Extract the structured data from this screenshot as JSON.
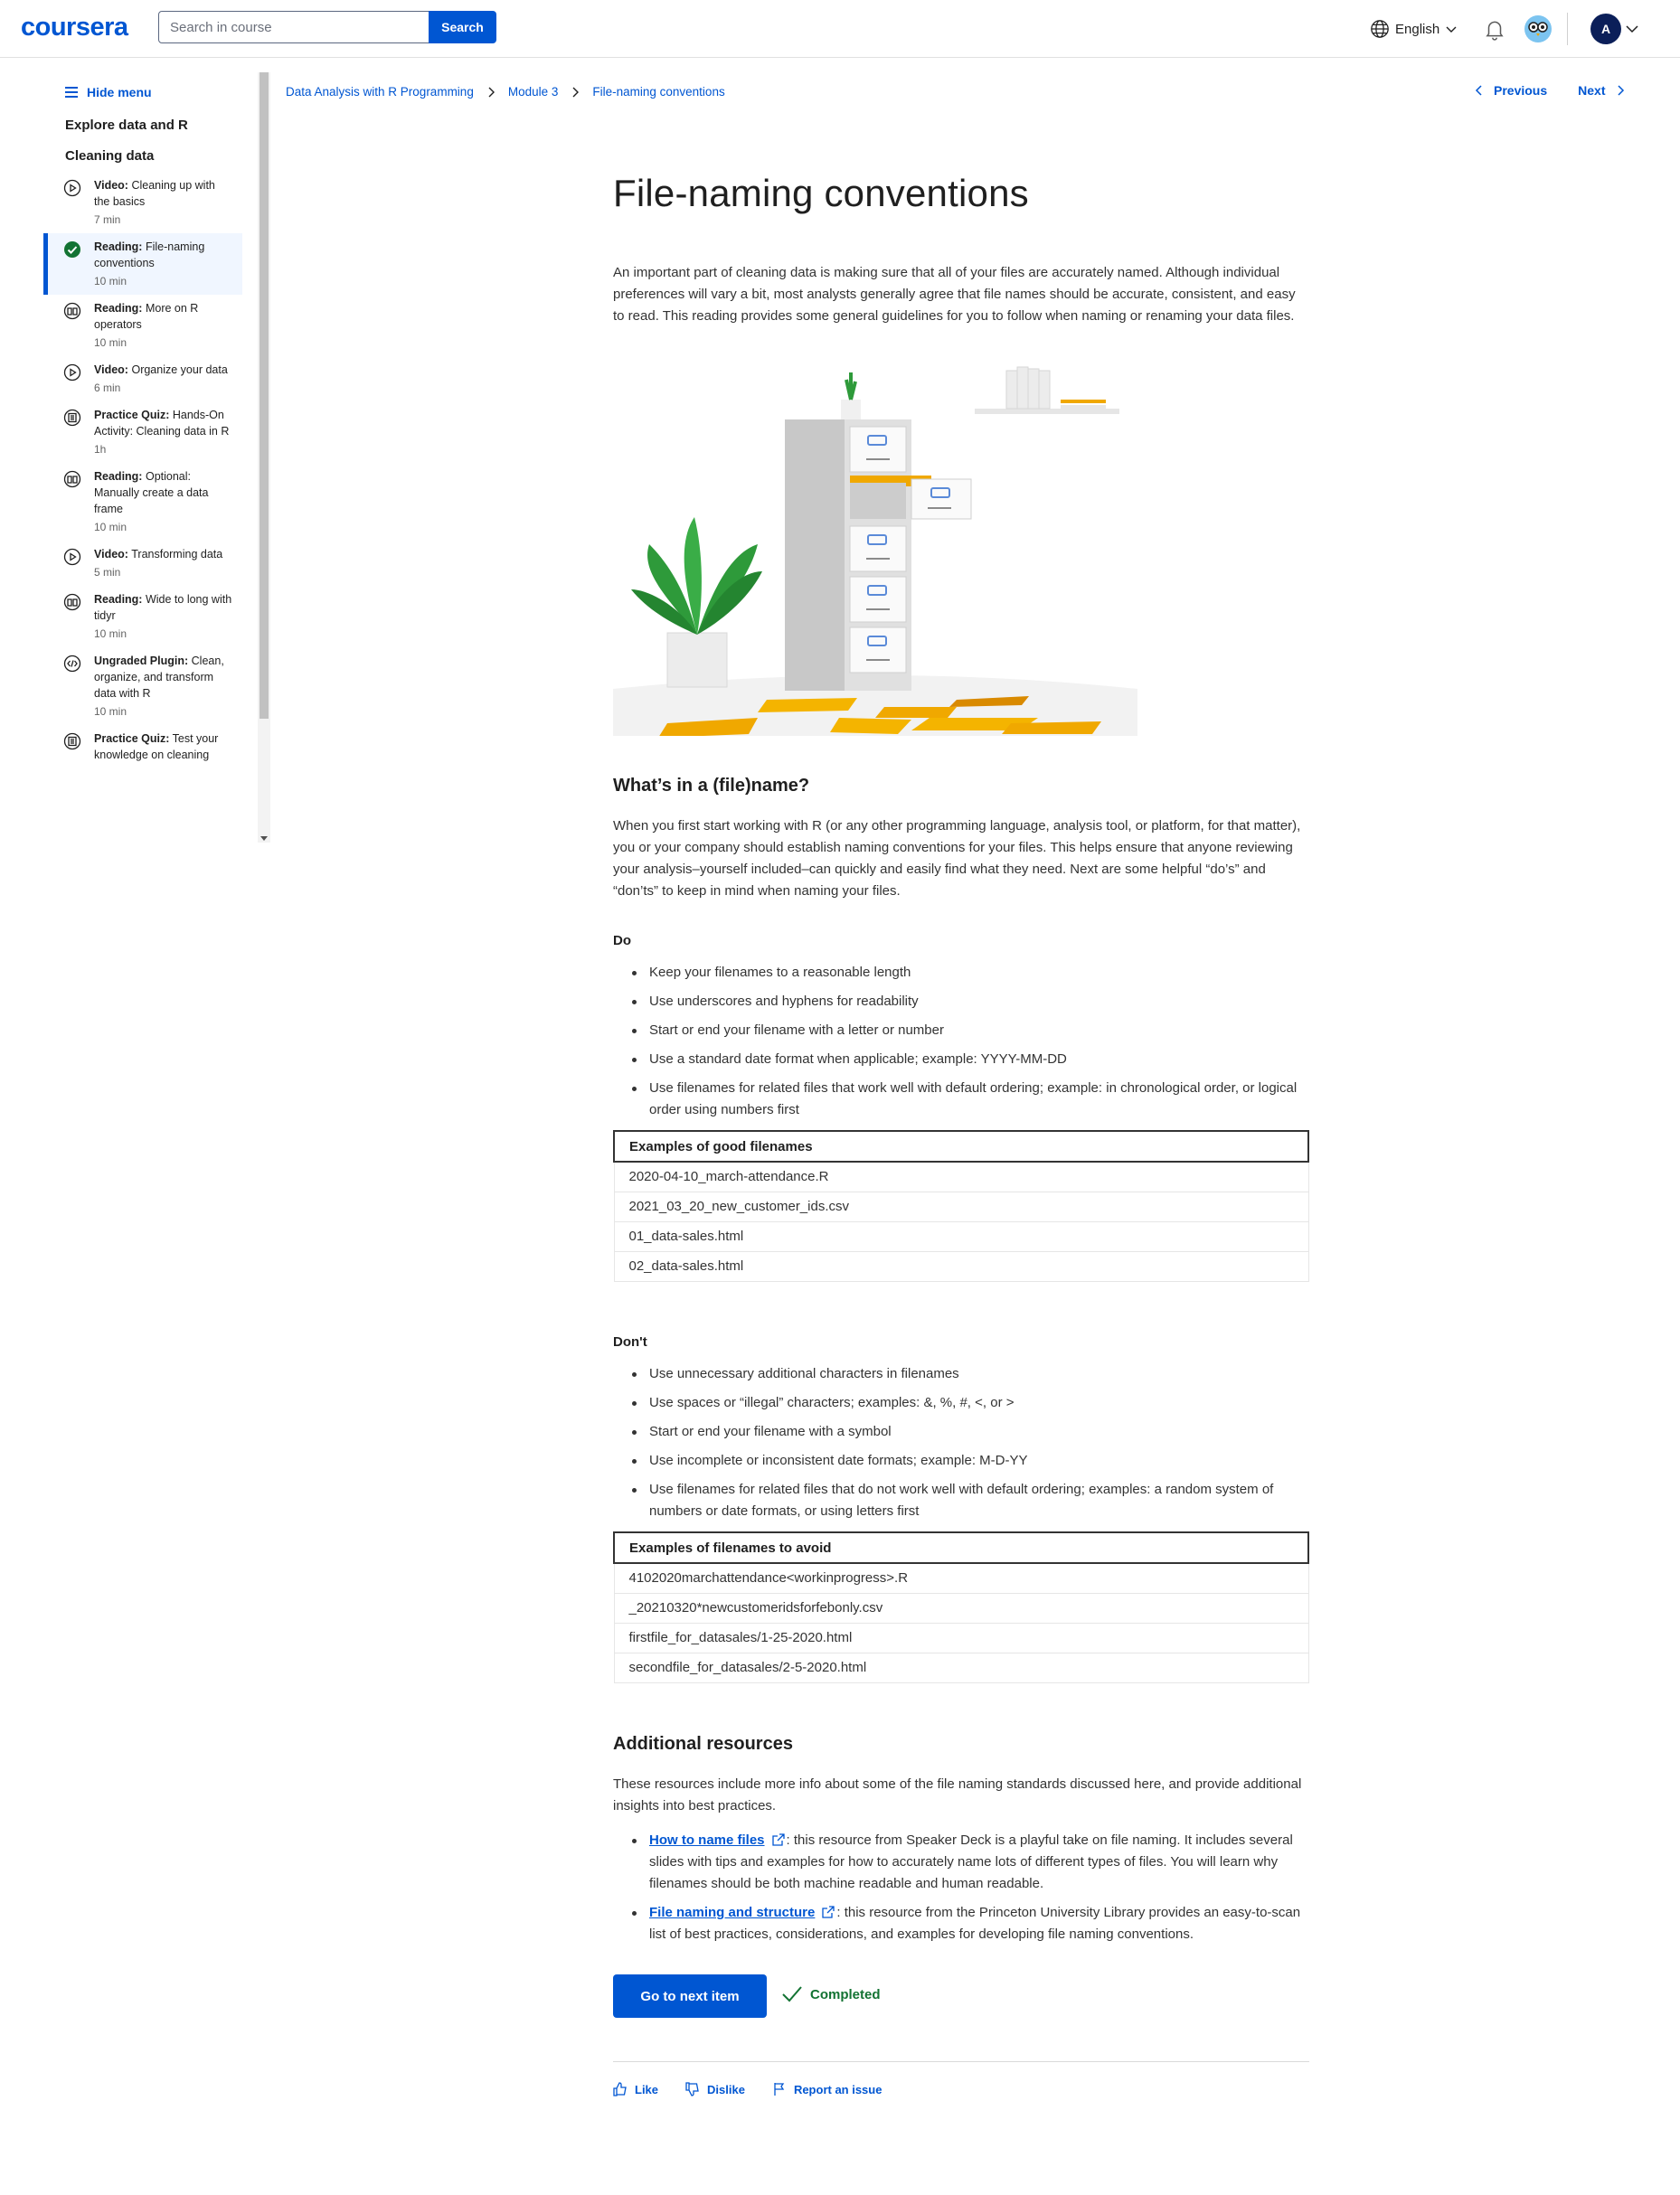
{
  "header": {
    "logo": "coursera",
    "search_placeholder": "Search in course",
    "search_button": "Search",
    "language": "English",
    "avatar_initial": "A"
  },
  "sidebar": {
    "hide_menu": "Hide menu",
    "module_title": "Explore data and R",
    "lesson_title": "Cleaning data",
    "items": [
      {
        "kind": "Video:",
        "title": "Cleaning up with the basics",
        "duration": "7 min",
        "icon": "play-circle-icon",
        "active": false
      },
      {
        "kind": "Reading:",
        "title": "File-naming conventions",
        "duration": "10 min",
        "icon": "check-circle-icon",
        "active": true
      },
      {
        "kind": "Reading:",
        "title": "More on R operators",
        "duration": "10 min",
        "icon": "book-icon",
        "active": false
      },
      {
        "kind": "Video:",
        "title": "Organize your data",
        "duration": "6 min",
        "icon": "play-circle-icon",
        "active": false
      },
      {
        "kind": "Practice Quiz:",
        "title": "Hands-On Activity: Cleaning data in R",
        "duration": "1h",
        "icon": "quiz-icon",
        "active": false
      },
      {
        "kind": "Reading:",
        "title": "Optional: Manually create a data frame",
        "duration": "10 min",
        "icon": "book-icon",
        "active": false
      },
      {
        "kind": "Video:",
        "title": "Transforming data",
        "duration": "5 min",
        "icon": "play-circle-icon",
        "active": false
      },
      {
        "kind": "Reading:",
        "title": "Wide to long with tidyr",
        "duration": "10 min",
        "icon": "book-icon",
        "active": false
      },
      {
        "kind": "Ungraded Plugin:",
        "title": "Clean, organize, and transform data with R",
        "duration": "10 min",
        "icon": "code-icon",
        "active": false
      },
      {
        "kind": "Practice Quiz:",
        "title": "Test your knowledge on cleaning",
        "duration": "",
        "icon": "quiz-icon",
        "active": false
      }
    ]
  },
  "breadcrumb": [
    "Data Analysis with R Programming",
    "Module 3",
    "File-naming conventions"
  ],
  "nav": {
    "previous": "Previous",
    "next": "Next"
  },
  "article": {
    "title": "File-naming conventions",
    "intro": "An important part of cleaning data is making sure that all of your files are accurately named. Although individual preferences will vary a bit, most analysts generally agree that file names should be accurate, consistent, and easy to read. This reading provides some general guidelines for you to follow when naming or renaming your data files.",
    "section1_heading": "What’s in a (file)name?",
    "section1_text": "When you first start working with R (or any other programming language, analysis tool, or platform, for that matter), you or your company should establish naming conventions for your files. This helps ensure that anyone reviewing your analysis–yourself included–can quickly and easily find what they need. Next are some helpful “do’s” and “don’ts” to keep in mind when naming your files.",
    "do_heading": "Do",
    "do_items": [
      "Keep your filenames to a reasonable length",
      "Use underscores and hyphens for readability",
      "Start or end your filename with a letter or number",
      "Use a standard date format when applicable; example: YYYY-MM-DD",
      "Use filenames for related files that work well with default ordering; example: in chronological order, or logical order using numbers first"
    ],
    "good_table_header": "Examples of good filenames",
    "good_table_rows": [
      "2020-04-10_march-attendance.R",
      "2021_03_20_new_customer_ids.csv",
      "01_data-sales.html",
      "02_data-sales.html"
    ],
    "dont_heading": "Don't",
    "dont_items": [
      "Use unnecessary additional characters in filenames",
      "Use spaces or “illegal” characters; examples: &, %, #, <, or >",
      "Start or end your filename with a symbol",
      "Use incomplete or inconsistent date formats; example: M-D-YY",
      "Use filenames for related files that do not work well with default ordering; examples: a random system of numbers or date formats, or using letters first"
    ],
    "avoid_table_header": "Examples of filenames to avoid",
    "avoid_table_rows": [
      "4102020marchattendance<workinprogress>.R",
      "_20210320*newcustomeridsforfebonly.csv",
      "firstfile_for_datasales/1-25-2020.html",
      "secondfile_for_datasales/2-5-2020.html"
    ],
    "resources_heading": "Additional resources",
    "resources_intro": "These resources include more info about some of the file naming standards discussed here, and provide additional insights into best practices.",
    "resources": [
      {
        "link": "How to name files",
        "text": ": this resource from Speaker Deck is a playful take on file naming. It includes several slides with tips and examples for how to accurately name lots of different types of files. You will learn why filenames should be both machine readable and human readable."
      },
      {
        "link": "File naming and structure",
        "text": ": this resource from the Princeton University Library provides an easy-to-scan list of best practices, considerations, and examples for developing file naming conventions."
      }
    ]
  },
  "footer": {
    "go_next": "Go to next item",
    "completed": "Completed",
    "like": "Like",
    "dislike": "Dislike",
    "report": "Report an issue"
  },
  "colors": {
    "brand": "#0056d2",
    "success": "#137333",
    "avatar": "#0b1f59"
  }
}
